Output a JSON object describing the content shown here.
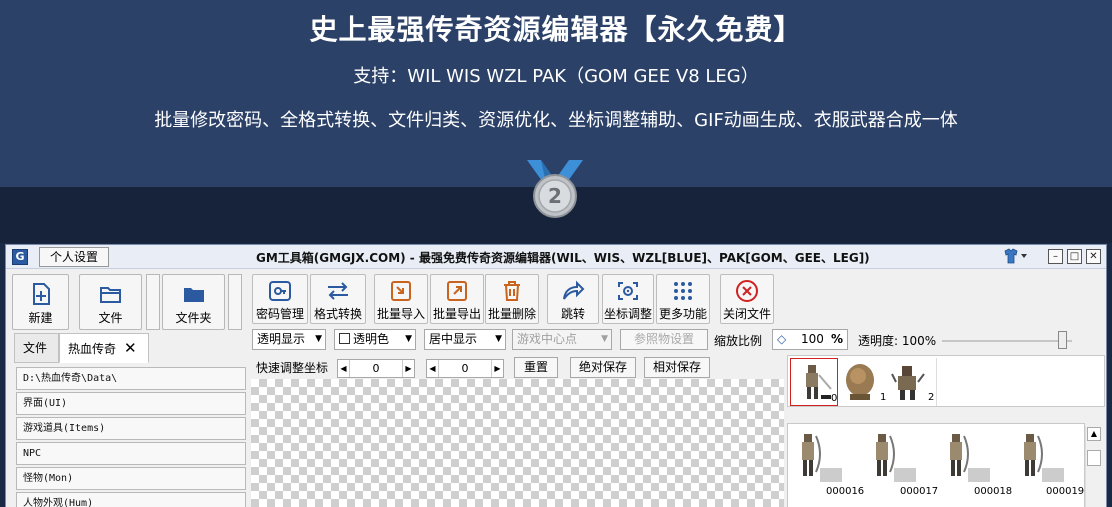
{
  "banner": {
    "title": "史上最强传奇资源编辑器【永久免费】",
    "support": "支持：WIL WIS WZL PAK（GOM GEE V8 LEG）",
    "features": "批量修改密码、全格式转换、文件归类、资源优化、坐标调整辅助、GIF动画生成、衣服武器合成一体",
    "medal_number": "2"
  },
  "window": {
    "logo": "G",
    "settings_button": "个人设置",
    "title": "GM工具箱(GMGJX.COM) - 最强免费传奇资源编辑器(WIL、WIS、WZL[BLUE]、PAK[GOM、GEE、LEG])",
    "shirt_icon": "shirt-icon",
    "controls": {
      "minimize": "–",
      "maximize": "□",
      "close": "✕"
    }
  },
  "left": {
    "buttons": [
      {
        "label": "新建",
        "icon": "new-file-icon"
      },
      {
        "label": "文件",
        "icon": "folder-open-icon"
      },
      {
        "label": "文件夹",
        "icon": "folder-icon"
      }
    ],
    "tabs": [
      {
        "label": "文件"
      },
      {
        "label": "热血传奇",
        "close": "✕"
      }
    ],
    "tree": [
      "D:\\热血传奇\\Data\\",
      "界面(UI)",
      "游戏道具(Items)",
      "NPC",
      "怪物(Mon)",
      "人物外观(Hum)"
    ]
  },
  "toolbar": {
    "tools": [
      {
        "label": "密码管理",
        "icon": "key-icon"
      },
      {
        "label": "格式转换",
        "icon": "convert-arrows-icon"
      },
      {
        "label": "批量导入",
        "icon": "import-icon"
      },
      {
        "label": "批量导出",
        "icon": "export-icon"
      },
      {
        "label": "批量删除",
        "icon": "trash-icon"
      },
      {
        "label": "跳转",
        "icon": "jump-arrow-icon"
      },
      {
        "label": "坐标调整",
        "icon": "crosshair-icon"
      },
      {
        "label": "更多功能",
        "icon": "grid-dots-icon"
      },
      {
        "label": "关闭文件",
        "icon": "close-circle-icon"
      }
    ],
    "row2": {
      "display_mode": "透明显示",
      "transparent_color_label": "透明色",
      "center_mode": "居中显示",
      "game_center": "游戏中心点",
      "ref_settings": "参照物设置",
      "zoom_label": "缩放比例",
      "zoom_value": "100",
      "zoom_unit": "%",
      "opacity_label": "透明度: 100%"
    },
    "row3": {
      "quick_label": "快速调整坐标",
      "x_value": "0",
      "y_value": "0",
      "reset": "重置",
      "abs_save": "绝对保存",
      "rel_save": "相对保存"
    }
  },
  "thumbnails": {
    "top": [
      "0",
      "1",
      "2"
    ],
    "bottom": [
      "000016",
      "000017",
      "000018",
      "000019"
    ]
  },
  "colors": {
    "banner": "#2b4168",
    "accent": "#2c5aa0",
    "close_red": "#d02020"
  }
}
